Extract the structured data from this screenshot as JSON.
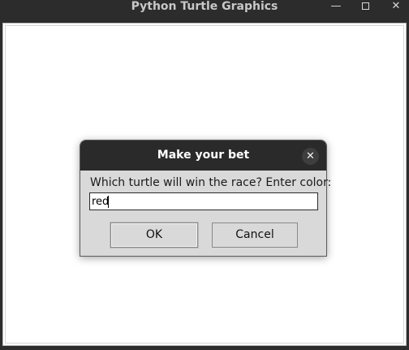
{
  "window": {
    "title": "Python Turtle Graphics",
    "minimize_glyph": "—",
    "close_glyph": "✕"
  },
  "dialog": {
    "title": "Make your bet",
    "close_glyph": "✕",
    "prompt": "Which turtle will win the race? Enter color:",
    "input_value": "red",
    "ok_label": "OK",
    "cancel_label": "Cancel"
  }
}
